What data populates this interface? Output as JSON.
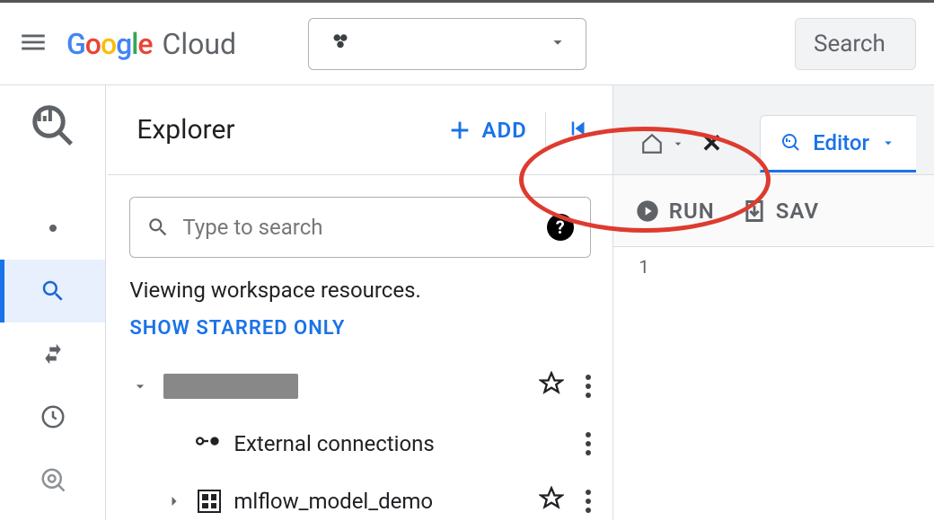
{
  "header": {
    "logo_google": "Google",
    "logo_cloud": "Cloud",
    "search_label": "Search"
  },
  "explorer": {
    "title": "Explorer",
    "add_label": "ADD",
    "search_placeholder": "Type to search",
    "viewing_text": "Viewing workspace resources.",
    "show_starred": "SHOW STARRED ONLY",
    "tree": {
      "external_conn_label": "External connections",
      "dataset_label": "mlflow_model_demo"
    }
  },
  "editor": {
    "tab_label": "Editor",
    "run_label": "RUN",
    "save_label": "SAV",
    "line_number": "1"
  }
}
